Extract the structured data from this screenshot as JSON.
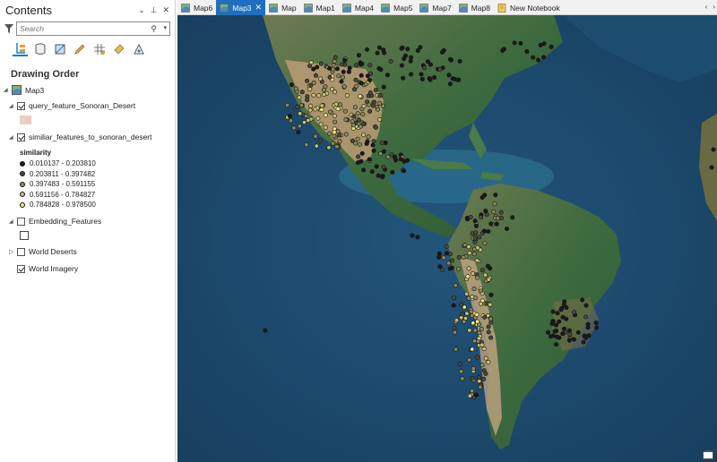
{
  "contents": {
    "title": "Contents",
    "controls": [
      "⌄",
      "⊥",
      "✕"
    ],
    "search_placeholder": "Search",
    "drawing_order_label": "Drawing Order"
  },
  "layers": {
    "map": "Map3",
    "query_layer": "query_feature_Sonoran_Desert",
    "similar_layer": "similiar_features_to_sonoran_desert",
    "similarity_field": "similarity",
    "embedding_layer": "Embedding_Features",
    "deserts_layer": "World Deserts",
    "imagery_layer": "World Imagery"
  },
  "legend": [
    {
      "label": "0.010137 - 0.203810",
      "color": "#1a1a1a"
    },
    {
      "label": "0.203811 - 0.397482",
      "color": "#4a4a3a"
    },
    {
      "label": "0.397483 - 0.591155",
      "color": "#8a8a5a"
    },
    {
      "label": "0.591156 - 0.784827",
      "color": "#c8c070"
    },
    {
      "label": "0.784828 - 0.978500",
      "color": "#f0e880"
    }
  ],
  "tabs": [
    {
      "label": "Map6",
      "selected": false
    },
    {
      "label": "Map3",
      "selected": true
    },
    {
      "label": "Map",
      "selected": false
    },
    {
      "label": "Map1",
      "selected": false
    },
    {
      "label": "Map4",
      "selected": false
    },
    {
      "label": "Map5",
      "selected": false
    },
    {
      "label": "Map7",
      "selected": false
    },
    {
      "label": "Map8",
      "selected": false
    },
    {
      "label": "New Notebook",
      "selected": false
    }
  ],
  "tab_close_glyph": "✕",
  "tab_scroll": [
    "‹",
    "›"
  ],
  "colors": {
    "accent": "#1e6fbf",
    "ocean": "#1c4a6e",
    "land": "#2f5a3a",
    "desert": "#c9a27c",
    "query_swatch": "#e8cfc3"
  }
}
